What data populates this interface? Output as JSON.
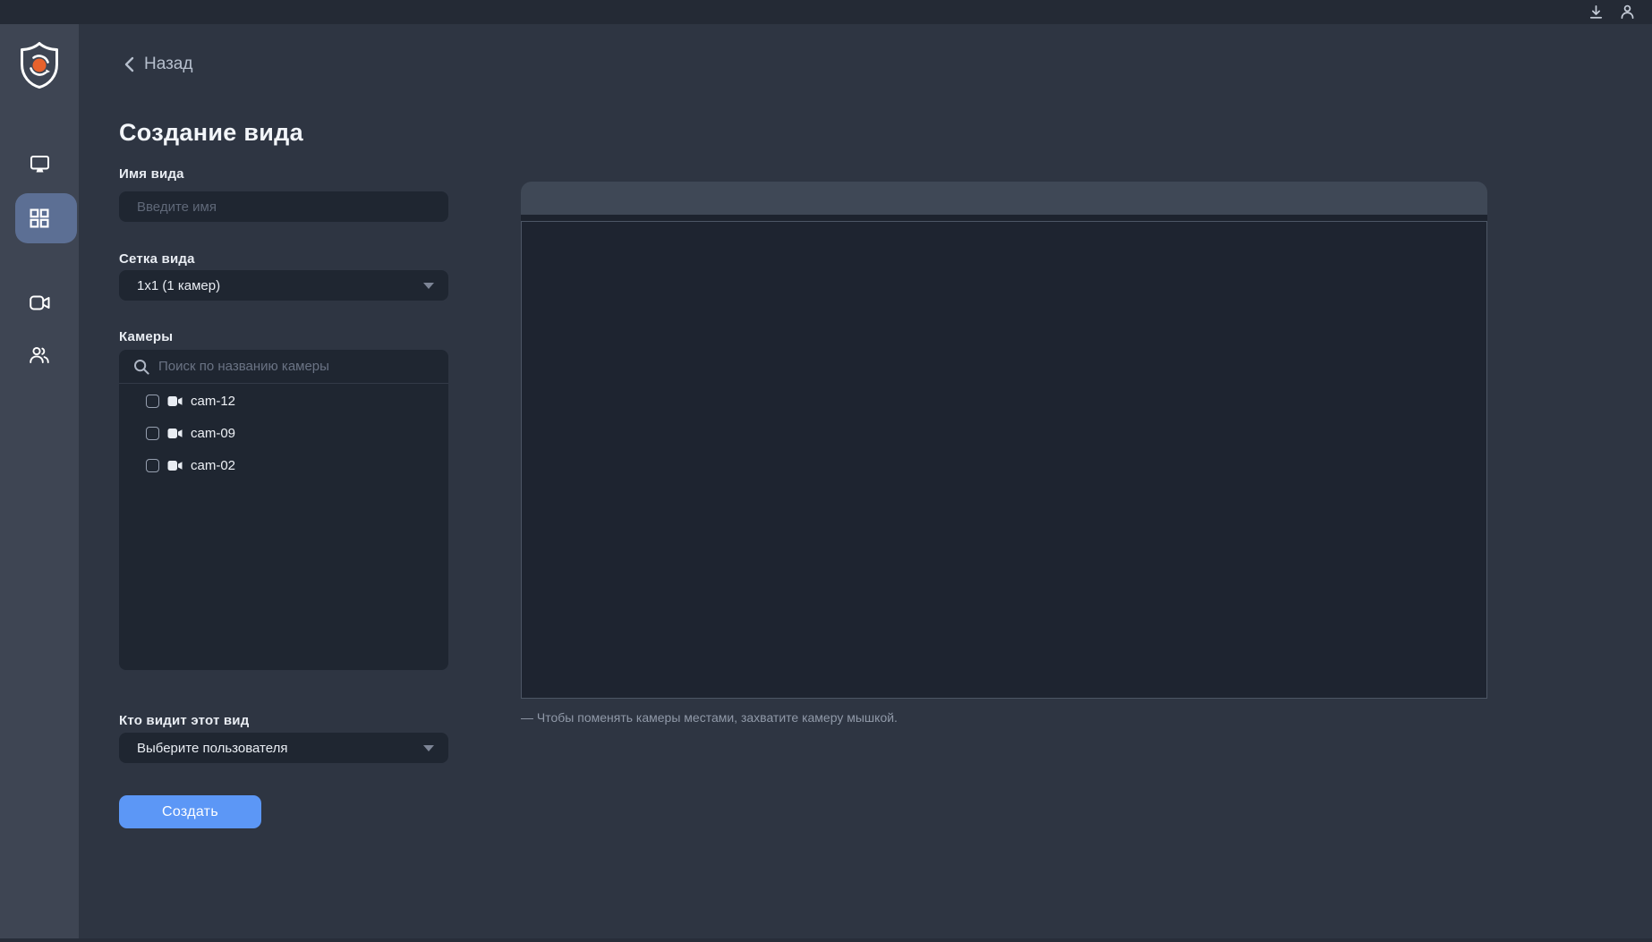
{
  "colors": {
    "accent_blue": "#5c97f6",
    "logo_orange": "#e8622c",
    "active_nav": "#5c6f94"
  },
  "topbar": {
    "icons": [
      {
        "name": "download-icon"
      },
      {
        "name": "account-icon"
      }
    ]
  },
  "sidebar": {
    "items": [
      {
        "id": "monitor",
        "icon": "monitor-icon",
        "active": false
      },
      {
        "id": "views",
        "icon": "grid-icon",
        "active": true
      },
      {
        "id": "cameras",
        "icon": "video-camera-icon",
        "active": false
      },
      {
        "id": "users",
        "icon": "users-icon",
        "active": false
      }
    ]
  },
  "header": {
    "back_label": "Назад",
    "title": "Создание вида"
  },
  "form": {
    "name_field": {
      "label": "Имя вида",
      "placeholder": "Введите имя",
      "value": ""
    },
    "grid_field": {
      "label": "Сетка вида",
      "value": "1x1 (1 камер)"
    },
    "cameras_field": {
      "label": "Камеры",
      "search_placeholder": "Поиск по названию камеры",
      "search_value": "",
      "items": [
        {
          "name": "cam-12",
          "checked": false
        },
        {
          "name": "cam-09",
          "checked": false
        },
        {
          "name": "cam-02",
          "checked": false
        }
      ]
    },
    "visibility_field": {
      "label": "Кто видит этот вид",
      "value": "Выберите пользователя"
    },
    "submit_label": "Создать"
  },
  "preview": {
    "hint": "— Чтобы поменять камеры местами, захватите камеру мышкой."
  }
}
